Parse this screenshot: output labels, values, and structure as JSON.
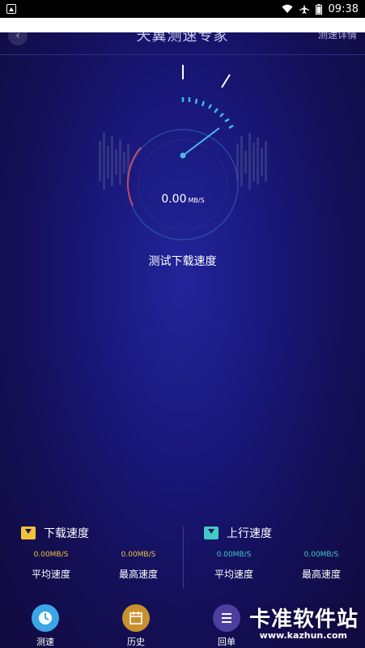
{
  "status_bar": {
    "time": "09:38"
  },
  "header": {
    "title": "天翼测速专家",
    "detail_link": "测速详情"
  },
  "gauge": {
    "speed_value": "0.00",
    "speed_unit": "MB/S"
  },
  "test_label": "测试下载速度",
  "stats": {
    "download": {
      "title": "下载速度",
      "avg_value": "0.00MB/S",
      "avg_label": "平均速度",
      "max_value": "0.00MB/S",
      "max_label": "最高速度"
    },
    "upload": {
      "title": "上行速度",
      "avg_value": "0.00MB/S",
      "avg_label": "平均速度",
      "max_value": "0.00MB/S",
      "max_label": "最高速度"
    }
  },
  "tabbar": {
    "items": [
      {
        "label": "测速",
        "icon": "clock-icon"
      },
      {
        "label": "历史",
        "icon": "calendar-icon"
      },
      {
        "label": "回单",
        "icon": "list-icon"
      }
    ]
  },
  "watermark": {
    "text": "卡准软件站",
    "url": "www.kazhun.com"
  },
  "colors": {
    "download_accent": "#f2c23a",
    "upload_accent": "#44c9c4",
    "background": "#19177a"
  }
}
